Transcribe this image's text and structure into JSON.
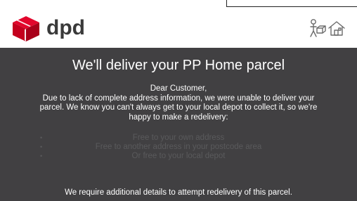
{
  "brand": {
    "name": "dpd",
    "primary_color": "#dc0032",
    "panel_color": "#414042"
  },
  "header": {
    "icon": "parcel-doorstep-icon"
  },
  "message": {
    "title": "We'll deliver your PP Home parcel",
    "lines": [
      "Dear Customer,",
      "Due to lack of complete address information, we were unable to deliver your",
      "parcel. We know you can't always get to your local depot to collect it, so we're",
      "happy to make a redelivery:"
    ],
    "options": [
      "Free to your own address",
      "Free to another address in your postcode area",
      "Or free to your local depot"
    ],
    "footer": "We require additional details to attempt redelivery of this parcel."
  }
}
